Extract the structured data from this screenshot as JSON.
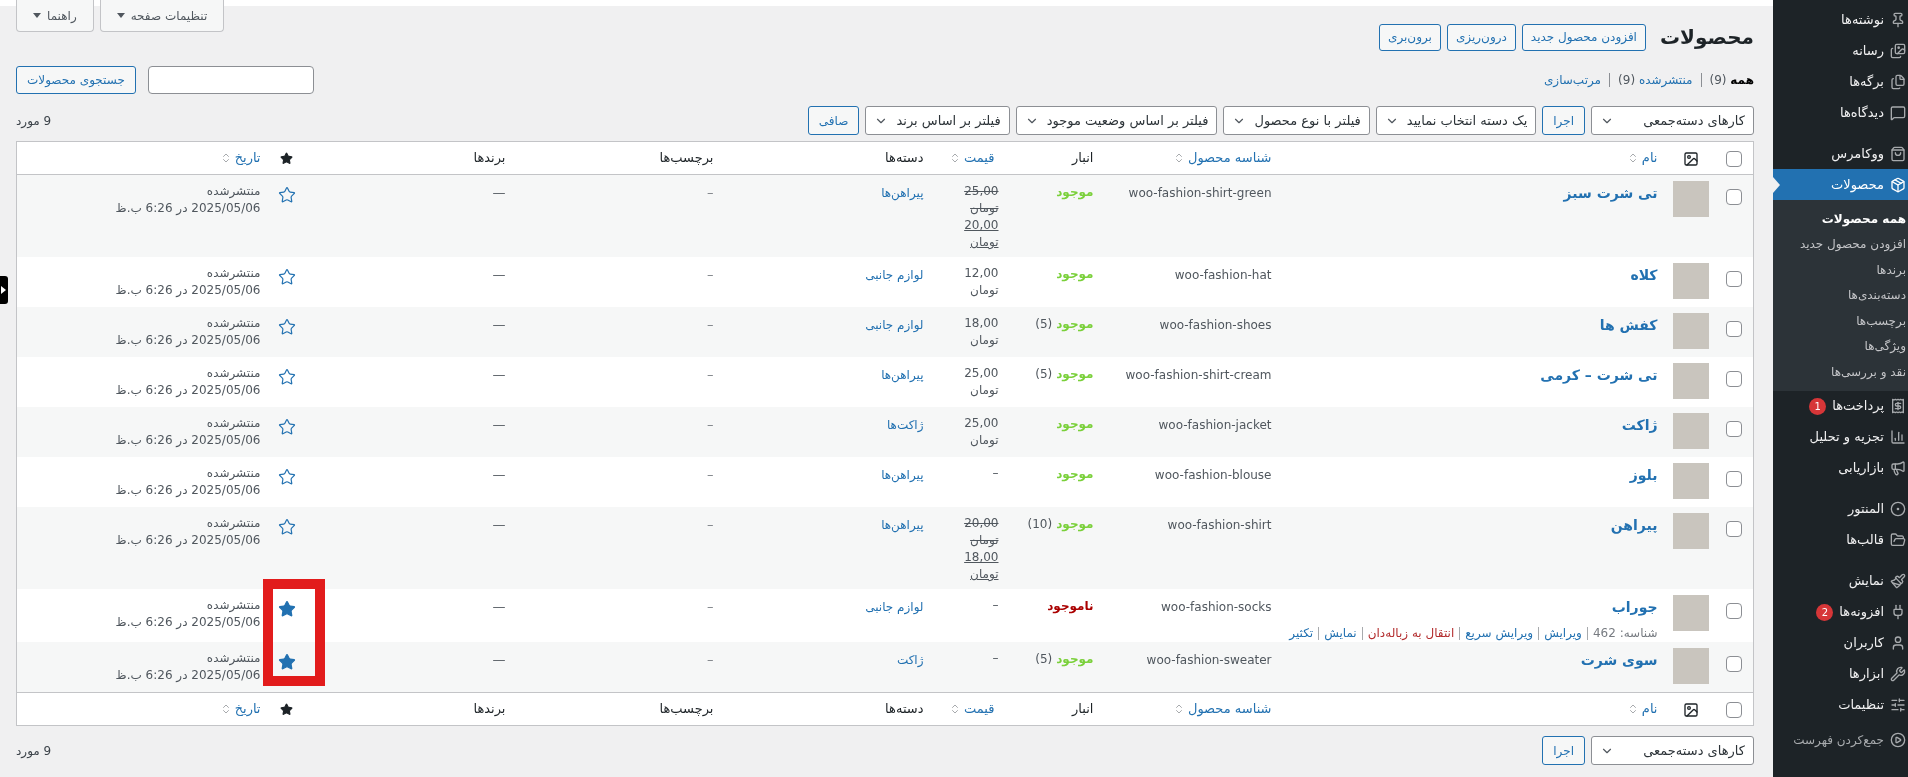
{
  "screen_options": [
    {
      "label": "تنظیمات صفحه"
    },
    {
      "label": "راهنما"
    }
  ],
  "page": {
    "title": "محصولات",
    "actions": [
      "افزودن محصول جدید",
      "درون‌ریزی",
      "برون‌بری"
    ]
  },
  "views": [
    {
      "label": "همه",
      "count": "(9)",
      "selected": true
    },
    {
      "label": "منتشرشده",
      "count": "(9)",
      "selected": false
    },
    {
      "label": "مرتب‌سازی",
      "selected": false
    }
  ],
  "search": {
    "button": "جستجوی محصولات"
  },
  "toolbar": {
    "bulk_action": "کارهای دسته‌جمعی",
    "apply": "اجرا",
    "filters": [
      "یک دسته انتخاب نمایید",
      "فیلتر با نوع محصول",
      "فیلتر بر اساس وضعیت موجود",
      "فیلتر بر اساس برند"
    ],
    "filter_button": "صافی",
    "count": "9 مورد"
  },
  "table": {
    "columns": [
      {
        "kind": "check",
        "checked": false
      },
      {
        "kind": "image"
      },
      {
        "kind": "text",
        "label": "نام",
        "sortable": true
      },
      {
        "kind": "text",
        "label": "شناسه محصول",
        "sortable": true
      },
      {
        "kind": "text",
        "label": "انبار",
        "sortable": false
      },
      {
        "kind": "text",
        "label": "قیمت",
        "sortable": true
      },
      {
        "kind": "text",
        "label": "دسته‌ها",
        "sortable": false
      },
      {
        "kind": "text",
        "label": "برچسب‌ها",
        "sortable": false
      },
      {
        "kind": "text",
        "label": "برندها",
        "sortable": false
      },
      {
        "kind": "featured"
      },
      {
        "kind": "text",
        "label": "تاریخ",
        "sortable": true
      }
    ],
    "rows": [
      {
        "checked": false,
        "name": "تی شرت سبز",
        "sku": "woo-fashion-shirt-green",
        "stock": {
          "kind": "in",
          "status": "موجود"
        },
        "price": {
          "regular": "25,00 تومان",
          "sale": "20,00 تومان"
        },
        "category": "پیراهن‌ها",
        "tags": "–",
        "brands": "—",
        "featured": false,
        "status": "منتشرشده",
        "date": "2025/05/06 در 6:26 ب.ظ"
      },
      {
        "checked": false,
        "name": "کلاه",
        "sku": "woo-fashion-hat",
        "stock": {
          "kind": "in",
          "status": "موجود"
        },
        "price": {
          "regular": "12,00 تومان"
        },
        "category": "لوازم جانبی",
        "tags": "–",
        "brands": "—",
        "featured": false,
        "status": "منتشرشده",
        "date": "2025/05/06 در 6:26 ب.ظ"
      },
      {
        "checked": false,
        "name": "کفش ها",
        "sku": "woo-fashion-shoes",
        "stock": {
          "kind": "in",
          "status": "موجود",
          "count": "(5)"
        },
        "price": {
          "regular": "18,00 تومان"
        },
        "category": "لوازم جانبی",
        "tags": "–",
        "brands": "—",
        "featured": false,
        "status": "منتشرشده",
        "date": "2025/05/06 در 6:26 ب.ظ"
      },
      {
        "checked": false,
        "name": "تی شرت – کرمی",
        "sku": "woo-fashion-shirt-cream",
        "stock": {
          "kind": "in",
          "status": "موجود",
          "count": "(5)"
        },
        "price": {
          "regular": "25,00 تومان"
        },
        "category": "پیراهن‌ها",
        "tags": "–",
        "brands": "—",
        "featured": false,
        "status": "منتشرشده",
        "date": "2025/05/06 در 6:26 ب.ظ"
      },
      {
        "checked": false,
        "name": "ژاکت",
        "sku": "woo-fashion-jacket",
        "stock": {
          "kind": "in",
          "status": "موجود"
        },
        "price": {
          "regular": "25,00 تومان"
        },
        "category": "ژاکت‌ها",
        "tags": "–",
        "brands": "—",
        "featured": false,
        "status": "منتشرشده",
        "date": "2025/05/06 در 6:26 ب.ظ"
      },
      {
        "checked": false,
        "name": "بلوز",
        "sku": "woo-fashion-blouse",
        "stock": {
          "kind": "in",
          "status": "موجود"
        },
        "price": {
          "regular": "–"
        },
        "category": "پیراهن‌ها",
        "tags": "–",
        "brands": "—",
        "featured": false,
        "status": "منتشرشده",
        "date": "2025/05/06 در 6:26 ب.ظ"
      },
      {
        "checked": false,
        "name": "پیراهن",
        "sku": "woo-fashion-shirt",
        "stock": {
          "kind": "in",
          "status": "موجود",
          "count": "(10)"
        },
        "price": {
          "regular": "20,00 تومان",
          "sale": "18,00 تومان"
        },
        "category": "پیراهن‌ها",
        "tags": "–",
        "brands": "—",
        "featured": false,
        "status": "منتشرشده",
        "date": "2025/05/06 در 6:26 ب.ظ"
      },
      {
        "checked": false,
        "name": "جوراب",
        "sku": "woo-fashion-socks",
        "stock": {
          "kind": "out",
          "status": "ناموجود"
        },
        "price": {
          "regular": "–"
        },
        "category": "لوازم جانبی",
        "tags": "–",
        "brands": "—",
        "featured": true,
        "status": "منتشرشده",
        "date": "2025/05/06 در 6:26 ب.ظ",
        "row_actions": {
          "id": "شناسه: 462",
          "links": [
            {
              "label": "ویرایش",
              "kind": "link"
            },
            {
              "label": "ویرایش سریع",
              "kind": "link"
            },
            {
              "label": "انتقال به زباله‌دان",
              "kind": "danger"
            },
            {
              "label": "نمایش",
              "kind": "link"
            },
            {
              "label": "تکثیر",
              "kind": "link"
            }
          ]
        }
      },
      {
        "checked": false,
        "name": "سوی شرت",
        "sku": "woo-fashion-sweater",
        "stock": {
          "kind": "in",
          "status": "موجود",
          "count": "(5)"
        },
        "price": {
          "regular": "–"
        },
        "category": "ژاکت",
        "tags": "–",
        "brands": "—",
        "featured": true,
        "status": "منتشرشده",
        "date": "2025/05/06 در 6:26 ب.ظ"
      }
    ],
    "footer_columns": [
      {
        "kind": "check",
        "checked": false
      },
      {
        "kind": "image"
      },
      {
        "kind": "text",
        "label": "نام",
        "sortable": true
      },
      {
        "kind": "text",
        "label": "شناسه محصول",
        "sortable": true
      },
      {
        "kind": "text",
        "label": "انبار",
        "sortable": false
      },
      {
        "kind": "text",
        "label": "قیمت",
        "sortable": true
      },
      {
        "kind": "text",
        "label": "دسته‌ها",
        "sortable": false
      },
      {
        "kind": "text",
        "label": "برچسب‌ها",
        "sortable": false
      },
      {
        "kind": "text",
        "label": "برندها",
        "sortable": false
      },
      {
        "kind": "featured"
      },
      {
        "kind": "text",
        "label": "تاریخ",
        "sortable": true
      }
    ]
  },
  "bottom_toolbar": {
    "bulk_action": "کارهای دسته‌جمعی",
    "apply": "اجرا",
    "count": "9 مورد"
  },
  "sidebar": {
    "groups": [
      [
        {
          "label": "نوشته‌ها",
          "selected": false
        },
        {
          "label": "رسانه",
          "selected": false
        },
        {
          "label": "برگه‌ها",
          "selected": false
        },
        {
          "label": "دیدگاه‌ها",
          "selected": false
        }
      ],
      [
        {
          "label": "ووکامرس",
          "selected": false
        },
        {
          "label": "محصولات",
          "selected": true,
          "children": [
            {
              "label": "همه محصولات",
              "selected": true
            },
            {
              "label": "افزودن محصول جدید",
              "selected": false
            },
            {
              "label": "برندها",
              "selected": false
            },
            {
              "label": "دسته‌بندی‌ها",
              "selected": false
            },
            {
              "label": "برچسب‌ها",
              "selected": false
            },
            {
              "label": "ویژگی‌ها",
              "selected": false
            },
            {
              "label": "نقد و بررسی‌ها",
              "selected": false
            }
          ]
        },
        {
          "label": "پرداخت‌ها",
          "badge": "1",
          "selected": false
        },
        {
          "label": "تجزیه و تحلیل",
          "selected": false
        },
        {
          "label": "بازاریابی",
          "selected": false
        }
      ],
      [
        {
          "label": "المنتور",
          "selected": false
        },
        {
          "label": "قالب‌ها",
          "selected": false
        }
      ],
      [
        {
          "label": "نمایش",
          "selected": false
        },
        {
          "label": "افزونه‌ها",
          "badge": "2",
          "selected": false
        },
        {
          "label": "کاربران",
          "selected": false
        },
        {
          "label": "ابزارها",
          "selected": false
        },
        {
          "label": "تنظیمات",
          "selected": false
        }
      ]
    ],
    "collapse": "جمع‌کردن فهرست"
  }
}
